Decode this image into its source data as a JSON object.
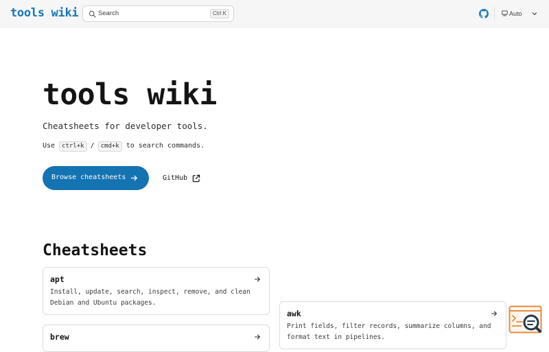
{
  "header": {
    "site_title": "tools wiki",
    "search": {
      "placeholder": "Search",
      "shortcut": "Ctrl K"
    },
    "github_icon": "github-icon",
    "theme": {
      "icon": "monitor-icon",
      "label": "Auto",
      "chevron": "chevron-down-icon"
    }
  },
  "hero": {
    "title": "tools wiki",
    "subtitle": "Cheatsheets for developer tools.",
    "hint_prefix": "Use",
    "hint_key_1": "ctrl+k",
    "hint_separator": "/",
    "hint_key_2": "cmd+k",
    "hint_suffix": "to search commands.",
    "primary_button": "Browse cheatsheets",
    "secondary_link": "GitHub"
  },
  "cheatsheets": {
    "title": "Cheatsheets",
    "cards": [
      {
        "name": "apt",
        "description": "Install, update, search, inspect, remove, and clean Debian and Ubuntu packages."
      },
      {
        "name": "awk",
        "description": "Print fields, filter records, summarize columns, and format text in pipelines."
      },
      {
        "name": "brew",
        "description": ""
      }
    ]
  },
  "widget": {
    "icon": "search-assistant-icon"
  },
  "colors": {
    "accent": "#1778b4",
    "button": "#1473b1",
    "widget_orange": "#e8893a",
    "widget_navy": "#1f3a4d"
  }
}
